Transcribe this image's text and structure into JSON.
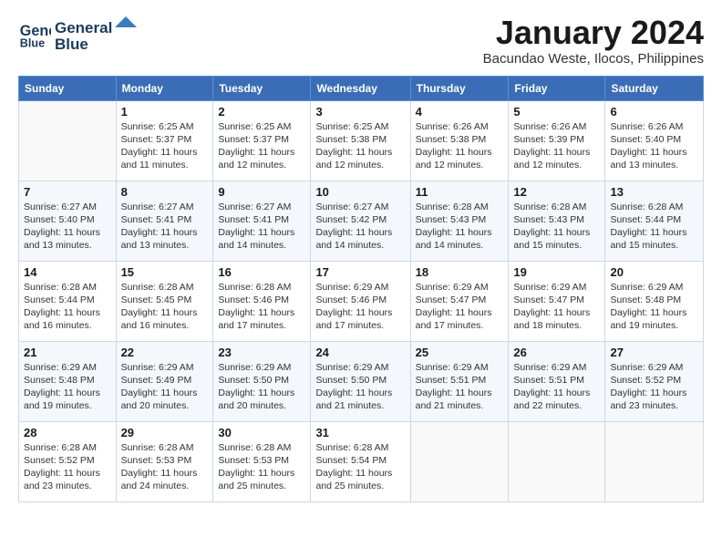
{
  "header": {
    "logo_line1": "General",
    "logo_line2": "Blue",
    "month_title": "January 2024",
    "location": "Bacundao Weste, Ilocos, Philippines"
  },
  "weekdays": [
    "Sunday",
    "Monday",
    "Tuesday",
    "Wednesday",
    "Thursday",
    "Friday",
    "Saturday"
  ],
  "weeks": [
    [
      {
        "day": "",
        "info": ""
      },
      {
        "day": "1",
        "info": "Sunrise: 6:25 AM\nSunset: 5:37 PM\nDaylight: 11 hours\nand 11 minutes."
      },
      {
        "day": "2",
        "info": "Sunrise: 6:25 AM\nSunset: 5:37 PM\nDaylight: 11 hours\nand 12 minutes."
      },
      {
        "day": "3",
        "info": "Sunrise: 6:25 AM\nSunset: 5:38 PM\nDaylight: 11 hours\nand 12 minutes."
      },
      {
        "day": "4",
        "info": "Sunrise: 6:26 AM\nSunset: 5:38 PM\nDaylight: 11 hours\nand 12 minutes."
      },
      {
        "day": "5",
        "info": "Sunrise: 6:26 AM\nSunset: 5:39 PM\nDaylight: 11 hours\nand 12 minutes."
      },
      {
        "day": "6",
        "info": "Sunrise: 6:26 AM\nSunset: 5:40 PM\nDaylight: 11 hours\nand 13 minutes."
      }
    ],
    [
      {
        "day": "7",
        "info": "Sunrise: 6:27 AM\nSunset: 5:40 PM\nDaylight: 11 hours\nand 13 minutes."
      },
      {
        "day": "8",
        "info": "Sunrise: 6:27 AM\nSunset: 5:41 PM\nDaylight: 11 hours\nand 13 minutes."
      },
      {
        "day": "9",
        "info": "Sunrise: 6:27 AM\nSunset: 5:41 PM\nDaylight: 11 hours\nand 14 minutes."
      },
      {
        "day": "10",
        "info": "Sunrise: 6:27 AM\nSunset: 5:42 PM\nDaylight: 11 hours\nand 14 minutes."
      },
      {
        "day": "11",
        "info": "Sunrise: 6:28 AM\nSunset: 5:43 PM\nDaylight: 11 hours\nand 14 minutes."
      },
      {
        "day": "12",
        "info": "Sunrise: 6:28 AM\nSunset: 5:43 PM\nDaylight: 11 hours\nand 15 minutes."
      },
      {
        "day": "13",
        "info": "Sunrise: 6:28 AM\nSunset: 5:44 PM\nDaylight: 11 hours\nand 15 minutes."
      }
    ],
    [
      {
        "day": "14",
        "info": "Sunrise: 6:28 AM\nSunset: 5:44 PM\nDaylight: 11 hours\nand 16 minutes."
      },
      {
        "day": "15",
        "info": "Sunrise: 6:28 AM\nSunset: 5:45 PM\nDaylight: 11 hours\nand 16 minutes."
      },
      {
        "day": "16",
        "info": "Sunrise: 6:28 AM\nSunset: 5:46 PM\nDaylight: 11 hours\nand 17 minutes."
      },
      {
        "day": "17",
        "info": "Sunrise: 6:29 AM\nSunset: 5:46 PM\nDaylight: 11 hours\nand 17 minutes."
      },
      {
        "day": "18",
        "info": "Sunrise: 6:29 AM\nSunset: 5:47 PM\nDaylight: 11 hours\nand 17 minutes."
      },
      {
        "day": "19",
        "info": "Sunrise: 6:29 AM\nSunset: 5:47 PM\nDaylight: 11 hours\nand 18 minutes."
      },
      {
        "day": "20",
        "info": "Sunrise: 6:29 AM\nSunset: 5:48 PM\nDaylight: 11 hours\nand 19 minutes."
      }
    ],
    [
      {
        "day": "21",
        "info": "Sunrise: 6:29 AM\nSunset: 5:48 PM\nDaylight: 11 hours\nand 19 minutes."
      },
      {
        "day": "22",
        "info": "Sunrise: 6:29 AM\nSunset: 5:49 PM\nDaylight: 11 hours\nand 20 minutes."
      },
      {
        "day": "23",
        "info": "Sunrise: 6:29 AM\nSunset: 5:50 PM\nDaylight: 11 hours\nand 20 minutes."
      },
      {
        "day": "24",
        "info": "Sunrise: 6:29 AM\nSunset: 5:50 PM\nDaylight: 11 hours\nand 21 minutes."
      },
      {
        "day": "25",
        "info": "Sunrise: 6:29 AM\nSunset: 5:51 PM\nDaylight: 11 hours\nand 21 minutes."
      },
      {
        "day": "26",
        "info": "Sunrise: 6:29 AM\nSunset: 5:51 PM\nDaylight: 11 hours\nand 22 minutes."
      },
      {
        "day": "27",
        "info": "Sunrise: 6:29 AM\nSunset: 5:52 PM\nDaylight: 11 hours\nand 23 minutes."
      }
    ],
    [
      {
        "day": "28",
        "info": "Sunrise: 6:28 AM\nSunset: 5:52 PM\nDaylight: 11 hours\nand 23 minutes."
      },
      {
        "day": "29",
        "info": "Sunrise: 6:28 AM\nSunset: 5:53 PM\nDaylight: 11 hours\nand 24 minutes."
      },
      {
        "day": "30",
        "info": "Sunrise: 6:28 AM\nSunset: 5:53 PM\nDaylight: 11 hours\nand 25 minutes."
      },
      {
        "day": "31",
        "info": "Sunrise: 6:28 AM\nSunset: 5:54 PM\nDaylight: 11 hours\nand 25 minutes."
      },
      {
        "day": "",
        "info": ""
      },
      {
        "day": "",
        "info": ""
      },
      {
        "day": "",
        "info": ""
      }
    ]
  ]
}
